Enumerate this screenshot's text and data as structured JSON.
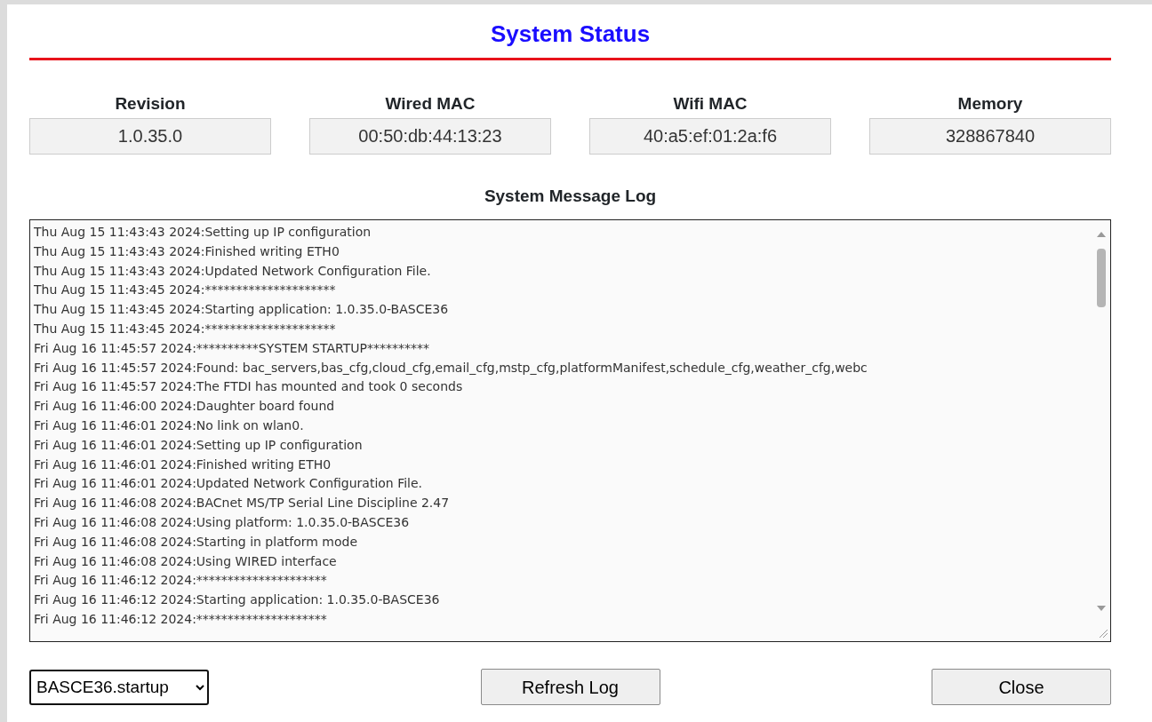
{
  "dialog": {
    "title": "System Status"
  },
  "info": [
    {
      "label": "Revision",
      "value": "1.0.35.0"
    },
    {
      "label": "Wired MAC",
      "value": "00:50:db:44:13:23"
    },
    {
      "label": "Wifi MAC",
      "value": "40:a5:ef:01:2a:f6"
    },
    {
      "label": "Memory",
      "value": "328867840"
    }
  ],
  "log": {
    "title": "System Message Log",
    "lines": [
      "Thu Aug 15 11:43:43 2024:Setting up IP configuration",
      "Thu Aug 15 11:43:43 2024:Finished writing ETH0",
      "Thu Aug 15 11:43:43 2024:Updated Network Configuration File.",
      "Thu Aug 15 11:43:45 2024:*********************",
      "Thu Aug 15 11:43:45 2024:Starting application: 1.0.35.0-BASCE36",
      "Thu Aug 15 11:43:45 2024:*********************",
      "Fri Aug 16 11:45:57 2024:**********SYSTEM STARTUP**********",
      "Fri Aug 16 11:45:57 2024:Found: bac_servers,bas_cfg,cloud_cfg,email_cfg,mstp_cfg,platformManifest,schedule_cfg,weather_cfg,webc",
      "Fri Aug 16 11:45:57 2024:The FTDI has mounted and took 0 seconds",
      "Fri Aug 16 11:46:00 2024:Daughter board found",
      "Fri Aug 16 11:46:01 2024:No link on wlan0.",
      "Fri Aug 16 11:46:01 2024:Setting up IP configuration",
      "Fri Aug 16 11:46:01 2024:Finished writing ETH0",
      "Fri Aug 16 11:46:01 2024:Updated Network Configuration File.",
      "Fri Aug 16 11:46:08 2024:BACnet MS/TP Serial Line Discipline 2.47",
      "Fri Aug 16 11:46:08 2024:Using platform: 1.0.35.0-BASCE36",
      "Fri Aug 16 11:46:08 2024:Starting in platform mode",
      "Fri Aug 16 11:46:08 2024:Using WIRED interface",
      "Fri Aug 16 11:46:12 2024:*********************",
      "Fri Aug 16 11:46:12 2024:Starting application: 1.0.35.0-BASCE36",
      "Fri Aug 16 11:46:12 2024:*********************"
    ]
  },
  "log_select": {
    "value": "BASCE36.startup"
  },
  "buttons": [
    {
      "label": "Refresh Log"
    },
    {
      "label": "Close"
    }
  ]
}
